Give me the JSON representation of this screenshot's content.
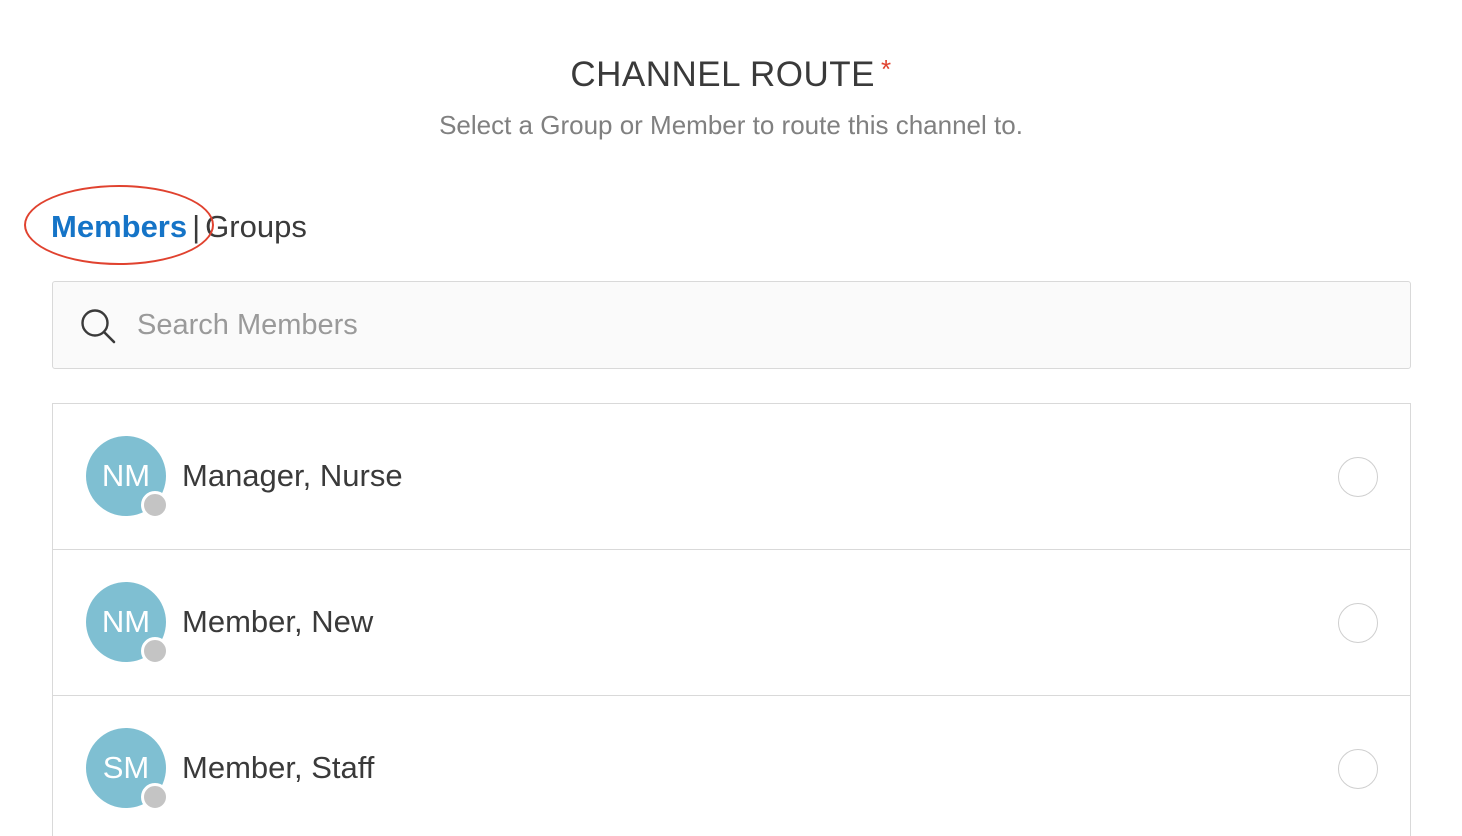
{
  "header": {
    "title": "CHANNEL ROUTE",
    "required_marker": "*",
    "subtitle": "Select a Group or Member to route this channel to."
  },
  "tabs": {
    "members_label": "Members",
    "separator": "|",
    "groups_label": "Groups",
    "active": "Members"
  },
  "search": {
    "placeholder": "Search Members",
    "value": "",
    "icon": "search-icon"
  },
  "members": [
    {
      "initials": "NM",
      "name": "Manager, Nurse",
      "presence": "offline",
      "selected": false
    },
    {
      "initials": "NM",
      "name": "Member, New",
      "presence": "offline",
      "selected": false
    },
    {
      "initials": "SM",
      "name": "Member, Staff",
      "presence": "offline",
      "selected": false
    }
  ],
  "colors": {
    "accent": "#1574c7",
    "required": "#e0422f",
    "avatar": "#7fbfd2",
    "presence_offline": "#c4c4c4",
    "annotation": "#e0422f"
  }
}
